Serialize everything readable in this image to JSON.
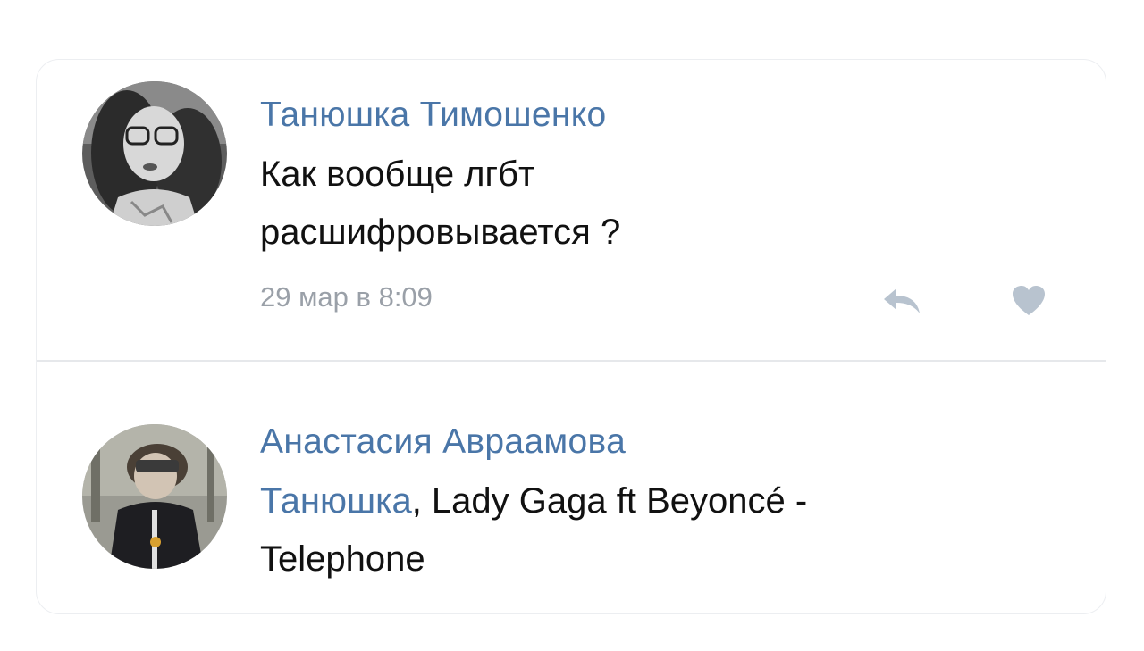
{
  "comments": [
    {
      "author": "Танюшка Тимошенко",
      "text_line1": "Как вообще лгбт",
      "text_line2": "расшифровывается ?",
      "date": "29 мар в 8:09",
      "actions": {
        "reply_icon": "reply-arrow",
        "like_icon": "heart"
      }
    },
    {
      "author": "Анастасия Авраамова",
      "mention": "Танюшка",
      "text_after_mention": ", Lady Gaga ft Beyoncé -",
      "text_line2": "Telephone"
    }
  ],
  "colors": {
    "author": "#4a76a8",
    "text": "#111111",
    "date": "#9aa0a8",
    "icon": "#b8c3cf",
    "divider": "#e6e8eb"
  }
}
